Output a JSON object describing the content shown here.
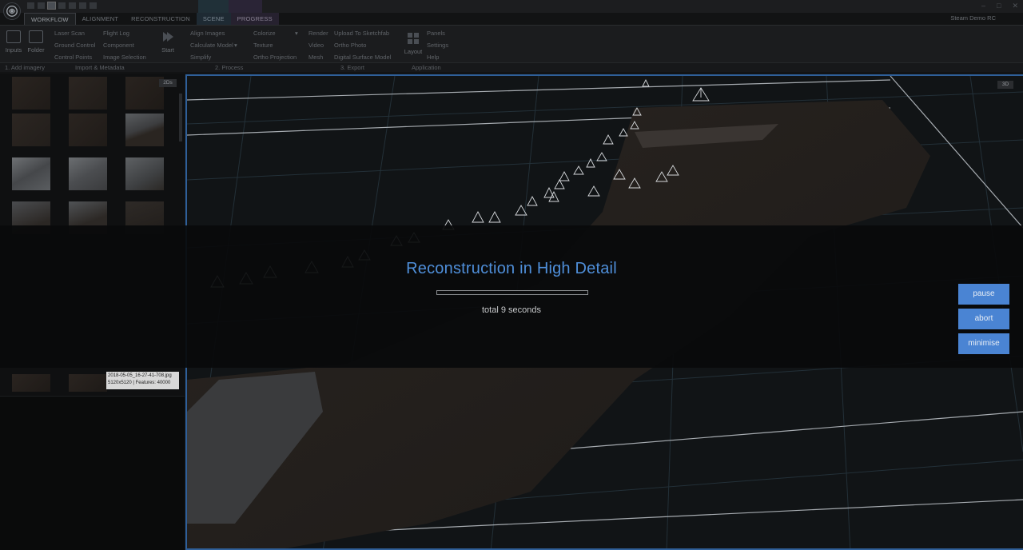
{
  "title_bar": {
    "app_name": "Steam Demo RC"
  },
  "ribbon": {
    "tabs": [
      {
        "label": "WORKFLOW",
        "name": "tab-workflow"
      },
      {
        "label": "ALIGNMENT",
        "name": "tab-alignment"
      },
      {
        "label": "RECONSTRUCTION",
        "name": "tab-reconstruction"
      },
      {
        "label": "SCENE",
        "name": "tab-scene"
      },
      {
        "label": "PROGRESS",
        "name": "tab-progress"
      }
    ],
    "add_imagery": {
      "inputs": "Inputs",
      "folder": "Folder",
      "group": "1. Add imagery"
    },
    "import_metadata": {
      "laser_scan": "Laser Scan",
      "ground_control": "Ground Control",
      "control_points": "Control Points",
      "flight_log": "Flight Log",
      "component": "Component",
      "image_selection": "Image Selection",
      "group": "Import & Metadata"
    },
    "process": {
      "start": "Start",
      "align_images": "Align Images",
      "calculate_model": "Calculate Model",
      "simplify": "Simplify",
      "colorize": "Colorize",
      "texture": "Texture",
      "ortho_projection": "Ortho Projection",
      "group": "2. Process"
    },
    "export": {
      "render": "Render",
      "video": "Video",
      "mesh": "Mesh",
      "upload": "Upload To Sketchfab",
      "ortho_photo": "Ortho Photo",
      "dsm": "Digital Surface Model",
      "group": "3. Export"
    },
    "application": {
      "layout": "Layout",
      "panels": "Panels",
      "settings": "Settings",
      "help": "Help",
      "group": "Application"
    }
  },
  "left_panel": {
    "view_tag": "2Ds",
    "tooltip": {
      "filename": "2018-05-05_16-27-41-708.jpg",
      "size": "5120x5120",
      "features": "Features: 40000"
    }
  },
  "viewport": {
    "view_tag": "3D"
  },
  "progress_overlay": {
    "title": "Reconstruction in High Detail",
    "progress": 0,
    "time_text": "total 9 seconds",
    "pause_label": "pause",
    "abort_label": "abort",
    "minimise_label": "minimise"
  },
  "colors": {
    "accent": "#4f8fda",
    "button": "#4a84d3",
    "viewport_border": "#2f5f99"
  }
}
